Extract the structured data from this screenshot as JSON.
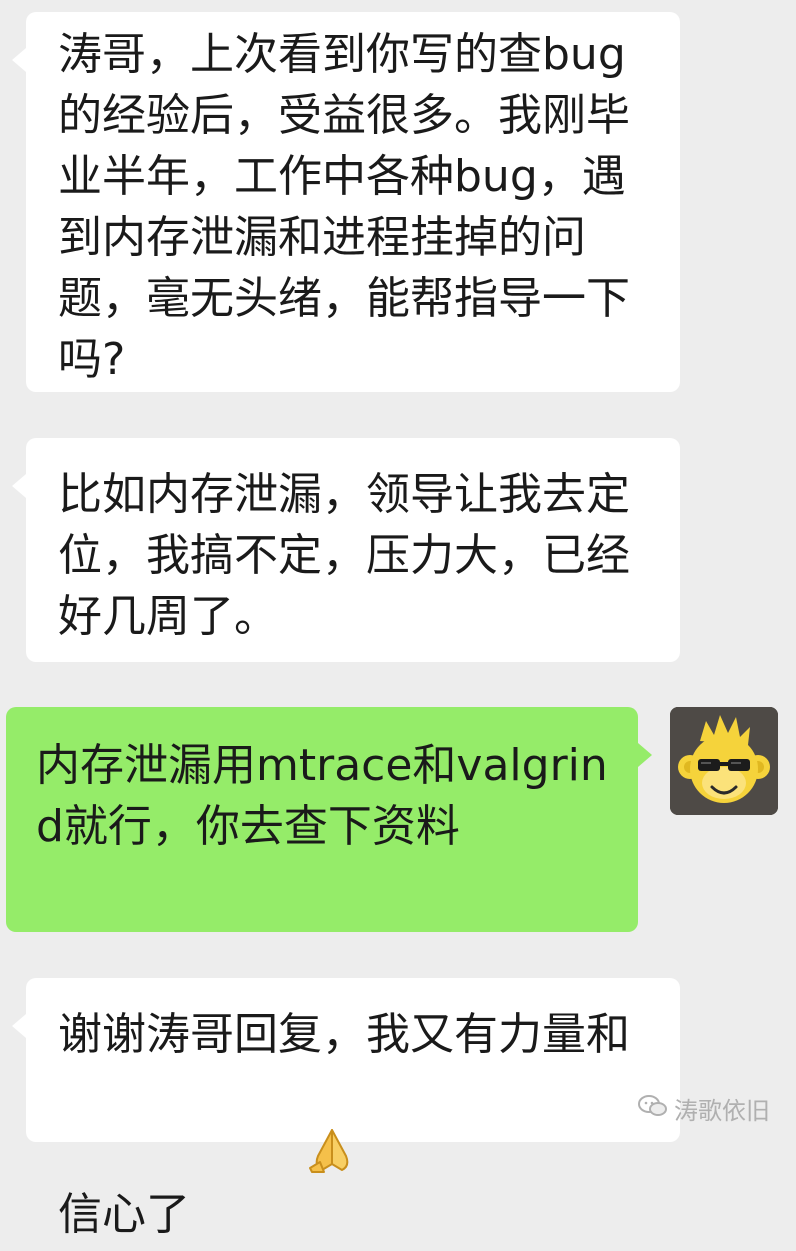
{
  "chat": {
    "messages": [
      {
        "sender": "peer",
        "text": "涛哥，上次看到你写的查bug的经验后，受益很多。我刚毕业半年，工作中各种bug，遇到内存泄漏和进程挂掉的问题，毫无头绪，能帮指导一下吗?"
      },
      {
        "sender": "peer",
        "text": "比如内存泄漏，领导让我去定位，我搞不定，压力大，已经好几周了。"
      },
      {
        "sender": "self",
        "text": "内存泄漏用mtrace和valgrind就行，你去查下资料"
      },
      {
        "sender": "peer",
        "text": "谢谢涛哥回复，我又有力量和信心了",
        "emoji": "praying-hands-emoji"
      }
    ],
    "self_avatar": {
      "icon": "cartoon-monkey-sunglasses-avatar",
      "colors": {
        "background": "#4e4a46",
        "face": "#f5d33b"
      }
    }
  },
  "watermark": {
    "icon": "wechat-official-account-icon",
    "text": "涛歌依旧"
  },
  "colors": {
    "background": "#ededed",
    "incoming_bubble": "#ffffff",
    "outgoing_bubble": "#95ec69",
    "text": "#1a1a1a"
  }
}
